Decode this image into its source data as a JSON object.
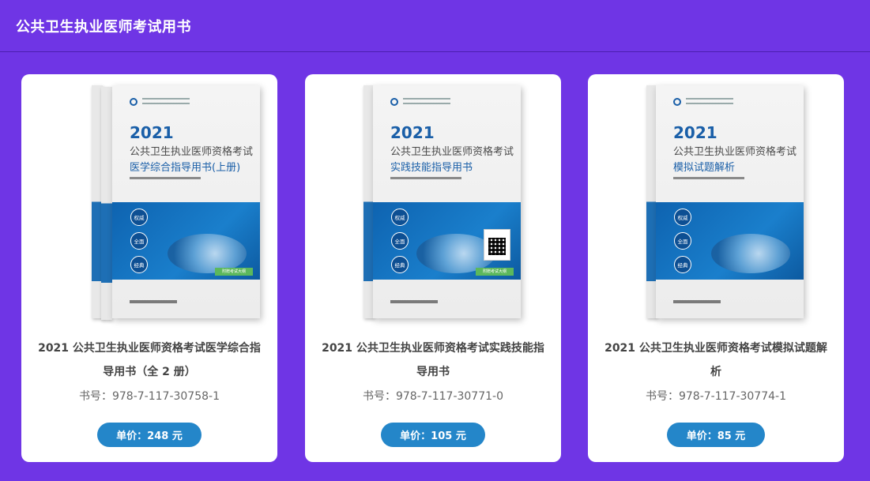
{
  "header": {
    "title": "公共卫生执业医师考试用书"
  },
  "books": [
    {
      "title": "2021 公共卫生执业医师资格考试医学综合指导用书（全 2 册）",
      "isbn": "书号：978-7-117-30758-1",
      "price": "单价：248 元",
      "cover": {
        "year": "2021",
        "line1": "公共卫生执业医师资格考试",
        "line2": "医学综合指导用书(上册)",
        "badges": [
          "权威",
          "全面",
          "经典"
        ],
        "tag": "附赠考试大纲"
      }
    },
    {
      "title": "2021 公共卫生执业医师资格考试实践技能指导用书",
      "isbn": "书号：978-7-117-30771-0",
      "price": "单价：105 元",
      "cover": {
        "year": "2021",
        "line1": "公共卫生执业医师资格考试",
        "line2": "实践技能指导用书",
        "badges": [
          "权威",
          "全面",
          "经典"
        ],
        "tag": "附赠考试大纲"
      }
    },
    {
      "title": "2021 公共卫生执业医师资格考试模拟试题解析",
      "isbn": "书号：978-7-117-30774-1",
      "price": "单价：85 元",
      "cover": {
        "year": "2021",
        "line1": "公共卫生执业医师资格考试",
        "line2": "模拟试题解析",
        "badges": [
          "权威",
          "全面",
          "经典"
        ]
      }
    }
  ]
}
